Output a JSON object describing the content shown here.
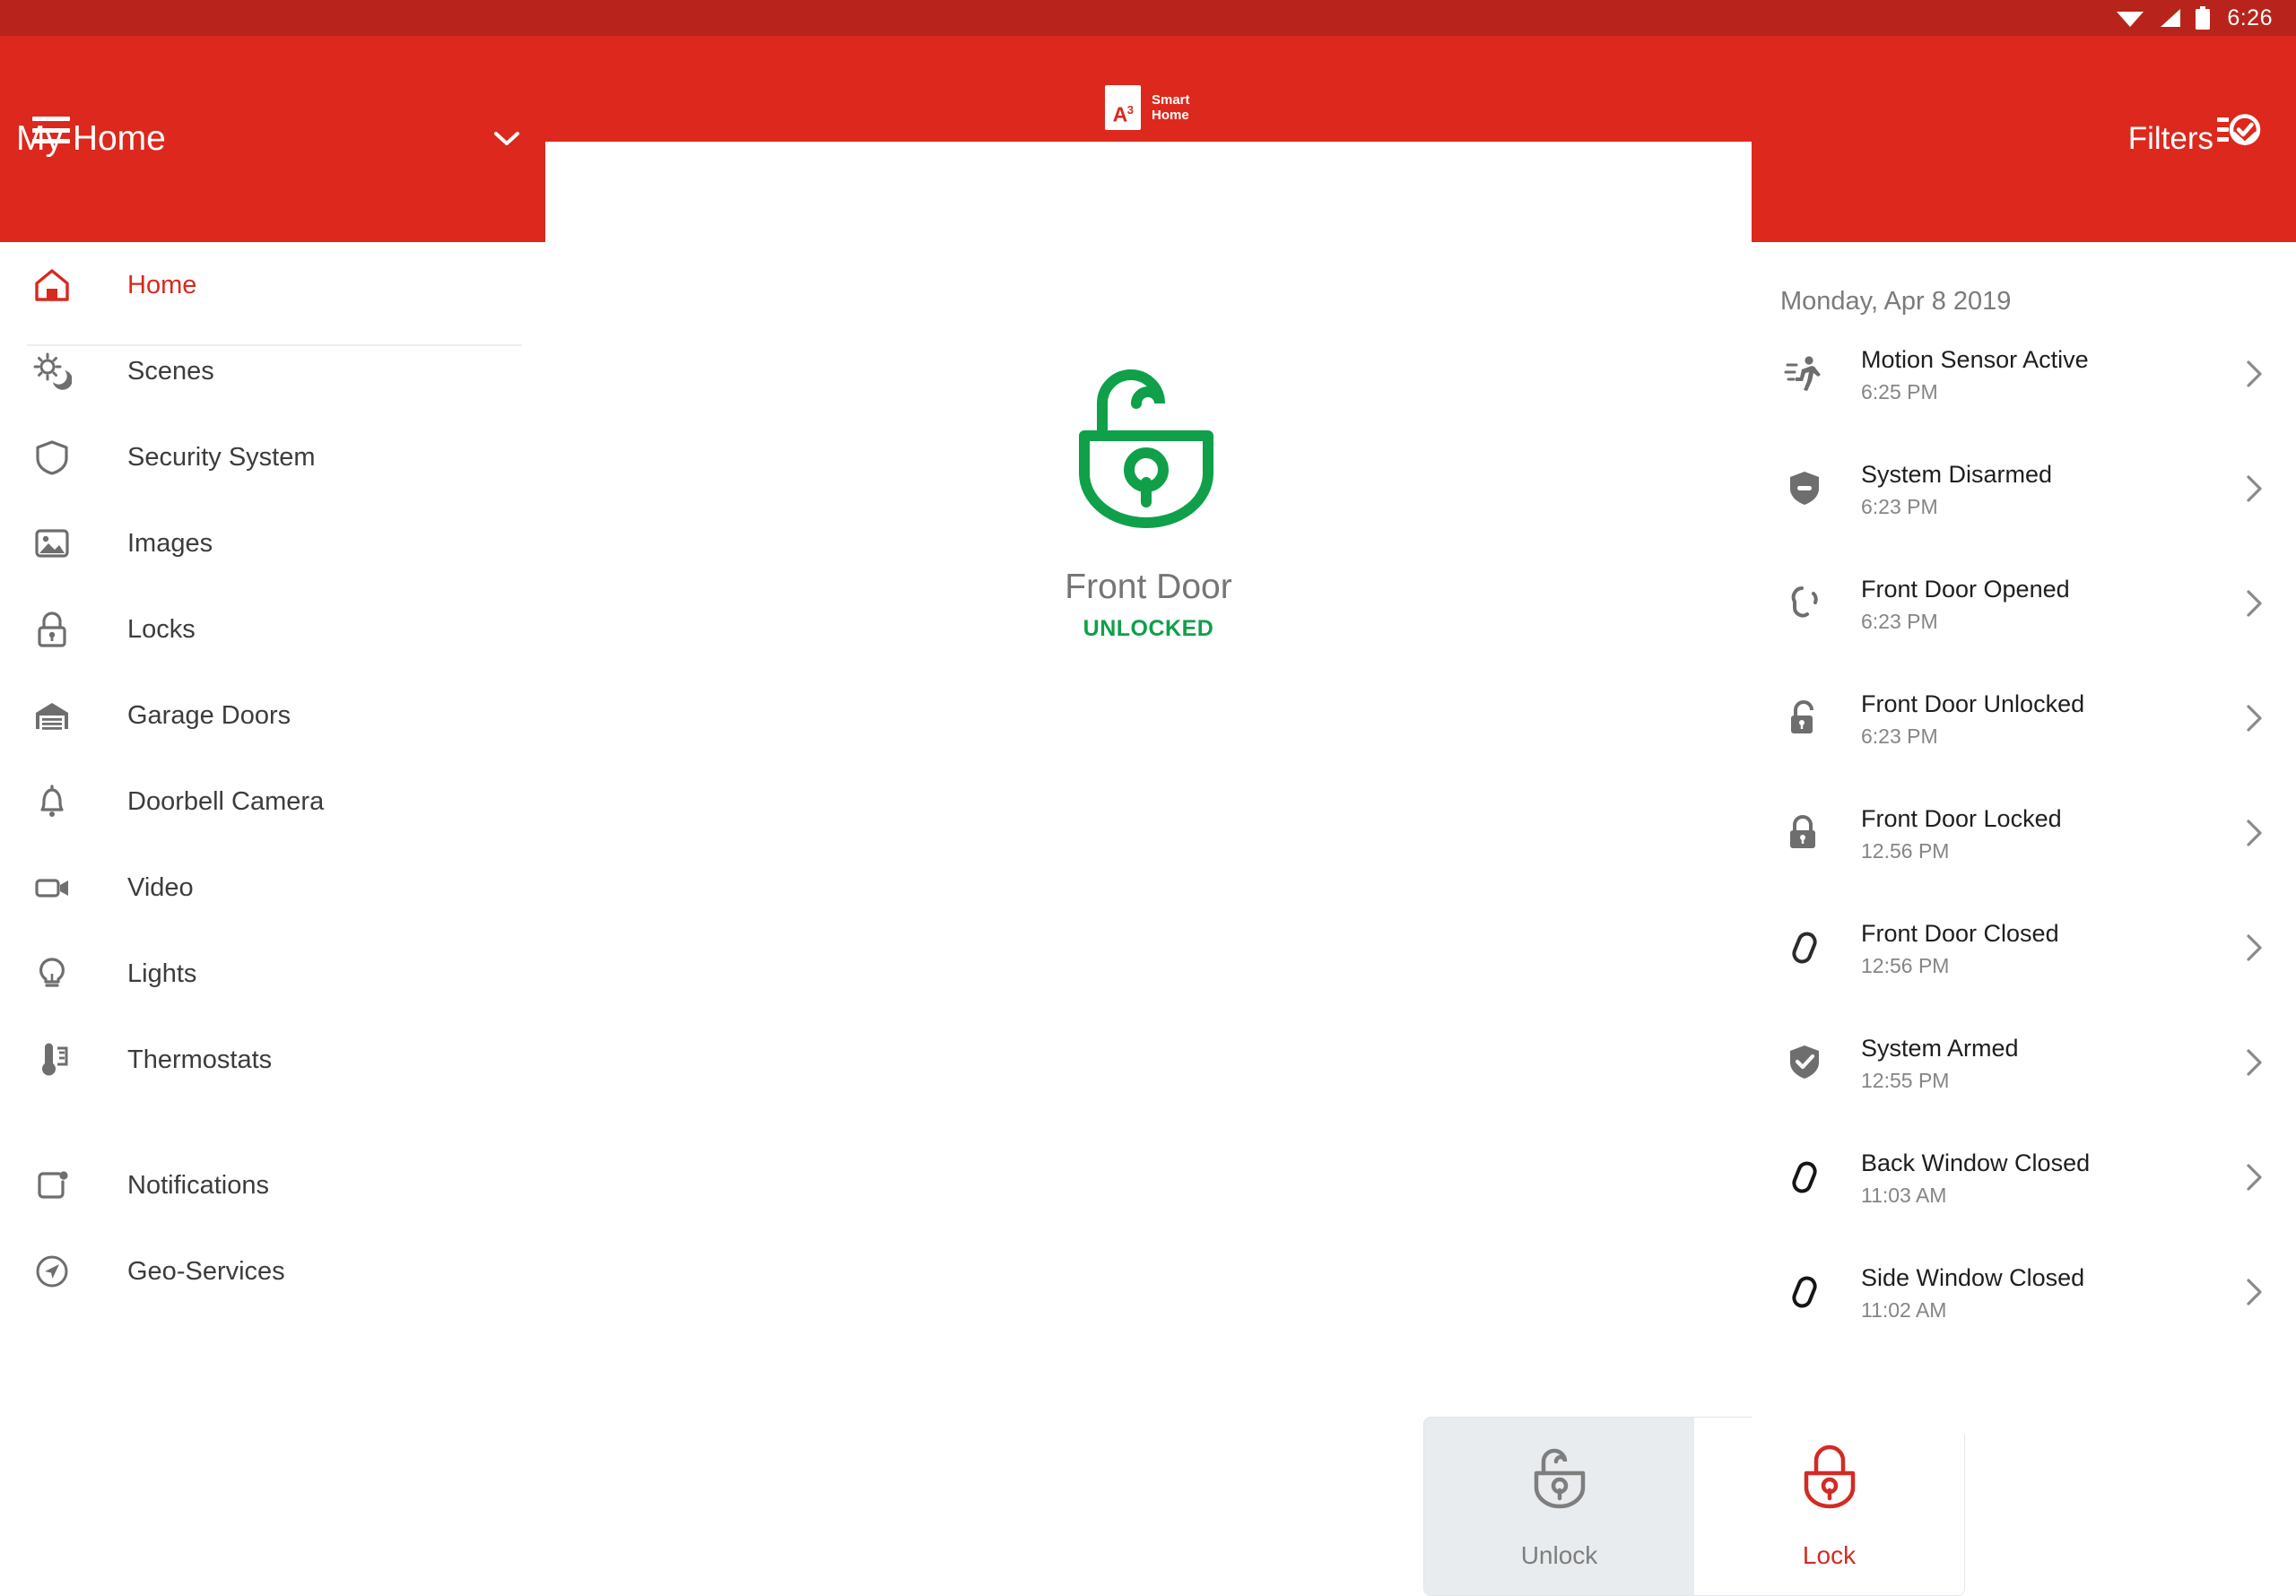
{
  "status_bar": {
    "time": "6:26",
    "icons": [
      "wifi-icon",
      "cellular-signal-icon",
      "battery-icon"
    ]
  },
  "app_bar": {
    "menu_icon": "hamburger-menu-icon",
    "logo_mark": "A",
    "logo_superscript": "3",
    "logo_line1": "Smart",
    "logo_line2": "Home",
    "activity_log_icon": "list-check-icon",
    "brand_color": "#DC281D",
    "status_bar_color": "#B8241B"
  },
  "home_selector": {
    "name": "My Home",
    "chevron_icon": "chevron-down-icon"
  },
  "filters": {
    "label": "Filters",
    "chevron_icon": "chevron-down-icon"
  },
  "sidebar": {
    "items": [
      {
        "label": "Home",
        "icon": "home-icon",
        "active": true
      },
      {
        "label": "Scenes",
        "icon": "sun-moon-icon",
        "active": false
      },
      {
        "label": "Security System",
        "icon": "shield-icon",
        "active": false
      },
      {
        "label": "Images",
        "icon": "image-icon",
        "active": false
      },
      {
        "label": "Locks",
        "icon": "lock-icon",
        "active": false
      },
      {
        "label": "Garage Doors",
        "icon": "garage-icon",
        "active": false
      },
      {
        "label": "Doorbell Camera",
        "icon": "bell-icon",
        "active": false
      },
      {
        "label": "Video",
        "icon": "video-icon",
        "active": false
      },
      {
        "label": "Lights",
        "icon": "lightbulb-icon",
        "active": false
      },
      {
        "label": "Thermostats",
        "icon": "thermostat-icon",
        "active": false
      }
    ],
    "secondary_items": [
      {
        "label": "Notifications",
        "icon": "notification-icon"
      },
      {
        "label": "Geo-Services",
        "icon": "navigation-icon"
      }
    ],
    "active_color": "#D9281D",
    "label_color": "#3C3C3C"
  },
  "device": {
    "name": "Front Door",
    "state": "UNLOCKED",
    "state_color": "#0FA049",
    "icon": "unlocked-padlock-icon"
  },
  "actions": [
    {
      "label": "Unlock",
      "icon": "unlock-icon",
      "selected": false,
      "color": "#7E7E7E"
    },
    {
      "label": "Lock",
      "icon": "lock-icon",
      "selected": true,
      "color": "#D32B24"
    }
  ],
  "activity": {
    "date": "Monday, Apr 8 2019",
    "events": [
      {
        "title": "Motion Sensor Active",
        "time": "6:25 PM",
        "icon": "running-person-icon"
      },
      {
        "title": "System Disarmed",
        "time": "6:23 PM",
        "icon": "shield-minus-icon"
      },
      {
        "title": "Front Door Opened",
        "time": "6:23 PM",
        "icon": "contact-open-icon"
      },
      {
        "title": "Front Door Unlocked",
        "time": "6:23 PM",
        "icon": "unlock-solid-icon"
      },
      {
        "title": "Front Door Locked",
        "time": "12.56 PM",
        "icon": "lock-solid-icon"
      },
      {
        "title": "Front Door Closed",
        "time": "12:56 PM",
        "icon": "contact-closed-icon"
      },
      {
        "title": "System Armed",
        "time": "12:55 PM",
        "icon": "shield-check-icon"
      },
      {
        "title": "Back Window Closed",
        "time": "11:03 AM",
        "icon": "contact-closed-icon"
      },
      {
        "title": "Side Window Closed",
        "time": "11:02 AM",
        "icon": "contact-closed-icon"
      }
    ],
    "chevron_icon": "chevron-right-icon"
  }
}
